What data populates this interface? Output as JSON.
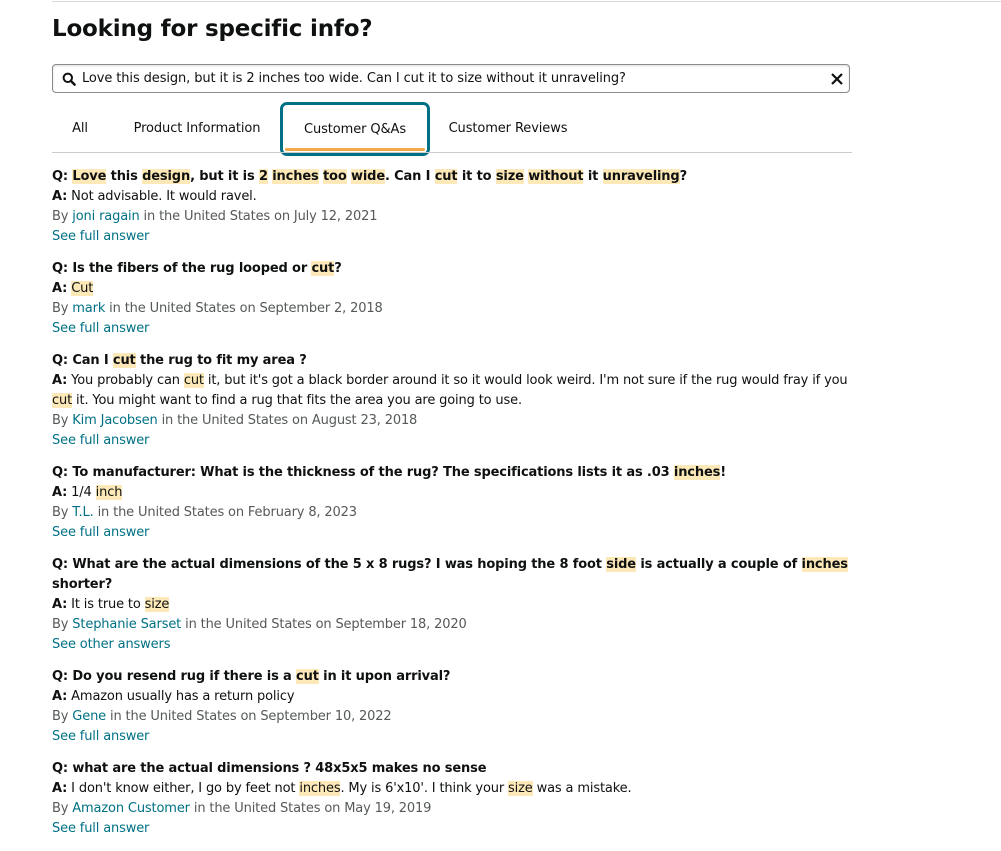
{
  "page": {
    "title": "Looking for specific info?"
  },
  "search": {
    "value": "Love this design, but it is 2 inches too wide. Can I cut it to size without it unraveling?",
    "search_icon": "search-icon",
    "clear_icon": "close-icon"
  },
  "tabs": [
    {
      "label": "All",
      "active": false
    },
    {
      "label": "Product Information",
      "active": false
    },
    {
      "label": "Customer Q&As",
      "active": true
    },
    {
      "label": "Customer Reviews",
      "active": false
    }
  ],
  "colors": {
    "accent_teal": "#007185",
    "tab_underline": "#f3a847",
    "highlight": "#fde8b8",
    "meta_gray": "#565959"
  },
  "qa": [
    {
      "q_prefix": "Q:",
      "question": [
        [
          "",
          "Love"
        ],
        [
          " this ",
          ""
        ],
        [
          "",
          "design"
        ],
        [
          ", but it is ",
          ""
        ],
        [
          "",
          "2"
        ],
        [
          " ",
          ""
        ],
        [
          "",
          "inches"
        ],
        [
          " ",
          ""
        ],
        [
          "",
          "too"
        ],
        [
          " ",
          ""
        ],
        [
          "",
          "wide"
        ],
        [
          ". Can I ",
          ""
        ],
        [
          "",
          "cut"
        ],
        [
          " it to ",
          ""
        ],
        [
          "",
          "size"
        ],
        [
          " ",
          ""
        ],
        [
          "",
          "without"
        ],
        [
          " it ",
          ""
        ],
        [
          "",
          "unraveling"
        ],
        [
          "?",
          ""
        ]
      ],
      "a_prefix": "A:",
      "answer": [
        [
          " Not advisable. It would ravel.",
          ""
        ]
      ],
      "by": "By",
      "author": "joni ragain",
      "location_date": "in the United States on July 12, 2021",
      "link": "See full answer"
    },
    {
      "q_prefix": "Q:",
      "question": [
        [
          " Is the fibers of the rug looped or ",
          ""
        ],
        [
          "",
          "cut"
        ],
        [
          "?",
          ""
        ]
      ],
      "a_prefix": "A:",
      "answer": [
        [
          " ",
          ""
        ],
        [
          "",
          "Cut"
        ]
      ],
      "by": "By",
      "author": "mark",
      "location_date": "in the United States on September 2, 2018",
      "link": "See full answer"
    },
    {
      "q_prefix": "Q:",
      "question": [
        [
          " Can I ",
          ""
        ],
        [
          "",
          "cut"
        ],
        [
          " the rug to fit my area ?",
          ""
        ]
      ],
      "a_prefix": "A:",
      "answer": [
        [
          " You probably can ",
          ""
        ],
        [
          "",
          "cut"
        ],
        [
          " it, but it's got a black border around it so it would look weird. I'm not sure if the rug would fray if you ",
          ""
        ],
        [
          "",
          "cut"
        ],
        [
          " it. You might want to find a rug that fits the area you are going to use.",
          ""
        ]
      ],
      "by": "By",
      "author": "Kim Jacobsen",
      "location_date": "in the United States on August 23, 2018",
      "link": "See full answer"
    },
    {
      "q_prefix": "Q:",
      "question": [
        [
          " To manufacturer: What is the thickness of the rug? The specifications lists it as .03 ",
          ""
        ],
        [
          "",
          "inches"
        ],
        [
          "!",
          ""
        ]
      ],
      "a_prefix": "A:",
      "answer": [
        [
          " 1/4 ",
          ""
        ],
        [
          "",
          "inch"
        ]
      ],
      "by": "By",
      "author": "T.L.",
      "location_date": "in the United States on February 8, 2023",
      "link": "See full answer"
    },
    {
      "q_prefix": "Q:",
      "question": [
        [
          " What are the actual dimensions of the 5 x 8 rugs? I was hoping the 8 foot ",
          ""
        ],
        [
          "",
          "side"
        ],
        [
          " is actually a couple of ",
          ""
        ],
        [
          "",
          "inches"
        ],
        [
          " shorter?",
          ""
        ]
      ],
      "a_prefix": "A:",
      "answer": [
        [
          " It is true to ",
          ""
        ],
        [
          "",
          "size"
        ]
      ],
      "by": "By",
      "author": "Stephanie Sarset",
      "location_date": "in the United States on September 18, 2020",
      "link": "See other answers"
    },
    {
      "q_prefix": "Q:",
      "question": [
        [
          " Do you resend rug if there is a ",
          ""
        ],
        [
          "",
          "cut"
        ],
        [
          " in it upon arrival?",
          ""
        ]
      ],
      "a_prefix": "A:",
      "answer": [
        [
          " Amazon usually has a return policy",
          ""
        ]
      ],
      "by": "By",
      "author": "Gene",
      "location_date": "in the United States on September 10, 2022",
      "link": "See full answer"
    },
    {
      "q_prefix": "Q:",
      "question": [
        [
          " what are the actual dimensions ? 48x5x5 makes no sense",
          ""
        ]
      ],
      "a_prefix": "A:",
      "answer": [
        [
          " I don't know either, I go by feet not ",
          ""
        ],
        [
          "",
          "inches"
        ],
        [
          ". My is 6'x10'. I think your ",
          ""
        ],
        [
          "",
          "size"
        ],
        [
          " was a mistake.",
          ""
        ]
      ],
      "by": "By",
      "author": "Amazon Customer",
      "location_date": "in the United States on May 19, 2019",
      "link": "See full answer"
    }
  ]
}
